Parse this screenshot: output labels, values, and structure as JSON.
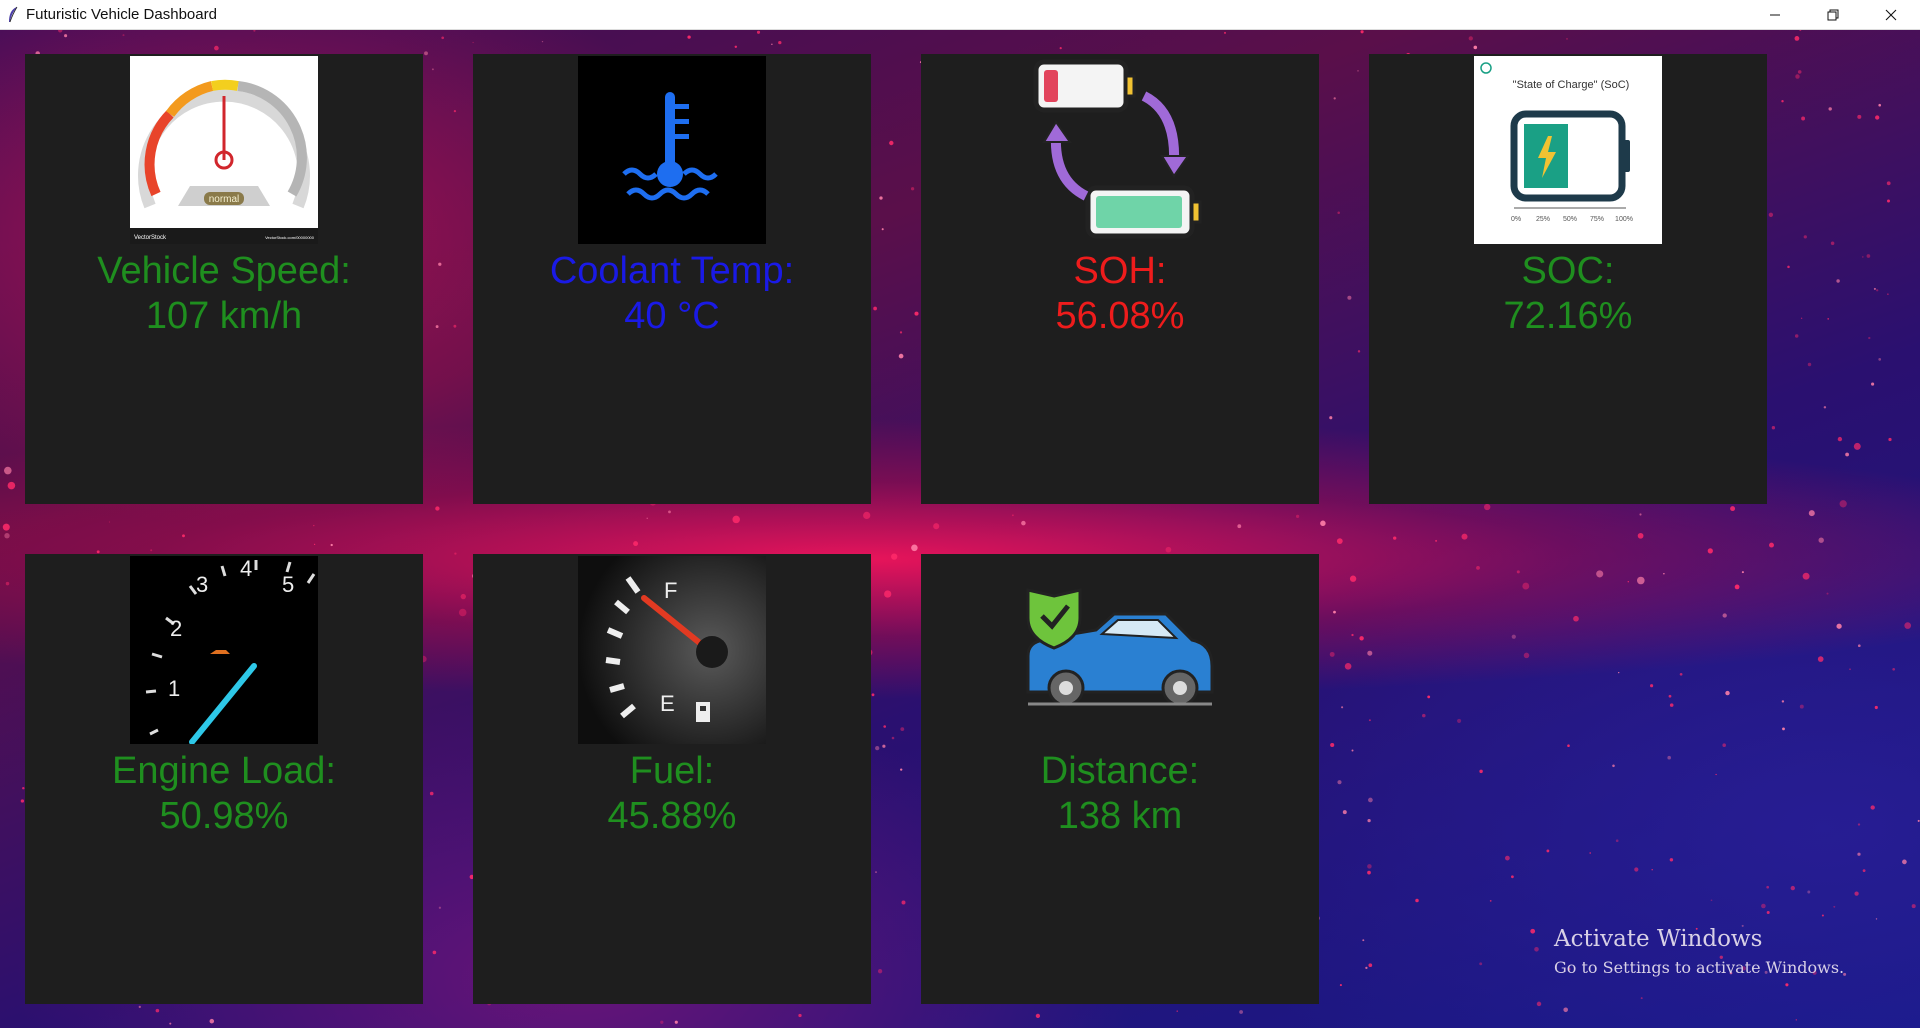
{
  "window": {
    "title": "Futuristic Vehicle Dashboard",
    "app_icon": "feather-icon",
    "controls": [
      "minimize-icon",
      "restore-icon",
      "close-icon"
    ]
  },
  "cards": {
    "speed": {
      "label": "Vehicle Speed:",
      "value": "107 km/h",
      "color": "#1f8f1f",
      "icon": "speedometer-icon",
      "image_caption": "normal",
      "image_credit_left": "VectorStock",
      "image_credit_right": "VectorStock.com/00000000"
    },
    "coolant": {
      "label": "Coolant Temp:",
      "value": "40 °C",
      "color": "#1a1ae6",
      "icon": "coolant-temperature-icon"
    },
    "soh": {
      "label": "SOH:",
      "value": "56.08%",
      "color": "#ee1c1c",
      "icon": "battery-cycle-icon"
    },
    "soc": {
      "label": "SOC:",
      "value": "72.16%",
      "color": "#1f8f1f",
      "icon": "state-of-charge-icon",
      "image_title": "\"State of Charge\" (SoC)",
      "image_ticks": [
        "0%",
        "25%",
        "50%",
        "75%",
        "100%"
      ]
    },
    "engine": {
      "label": "Engine Load:",
      "value": "50.98%",
      "color": "#1f8f1f",
      "icon": "tachometer-icon",
      "image_ticks": [
        "1",
        "2",
        "3",
        "4",
        "5"
      ]
    },
    "fuel": {
      "label": "Fuel:",
      "value": "45.88%",
      "color": "#1f8f1f",
      "icon": "fuel-gauge-icon",
      "image_full": "F",
      "image_empty": "E"
    },
    "distance": {
      "label": "Distance:",
      "value": "138 km",
      "color": "#1f8f1f",
      "icon": "car-shield-icon"
    }
  },
  "watermark": {
    "line1": "Activate Windows",
    "line2": "Go to Settings to activate Windows."
  }
}
